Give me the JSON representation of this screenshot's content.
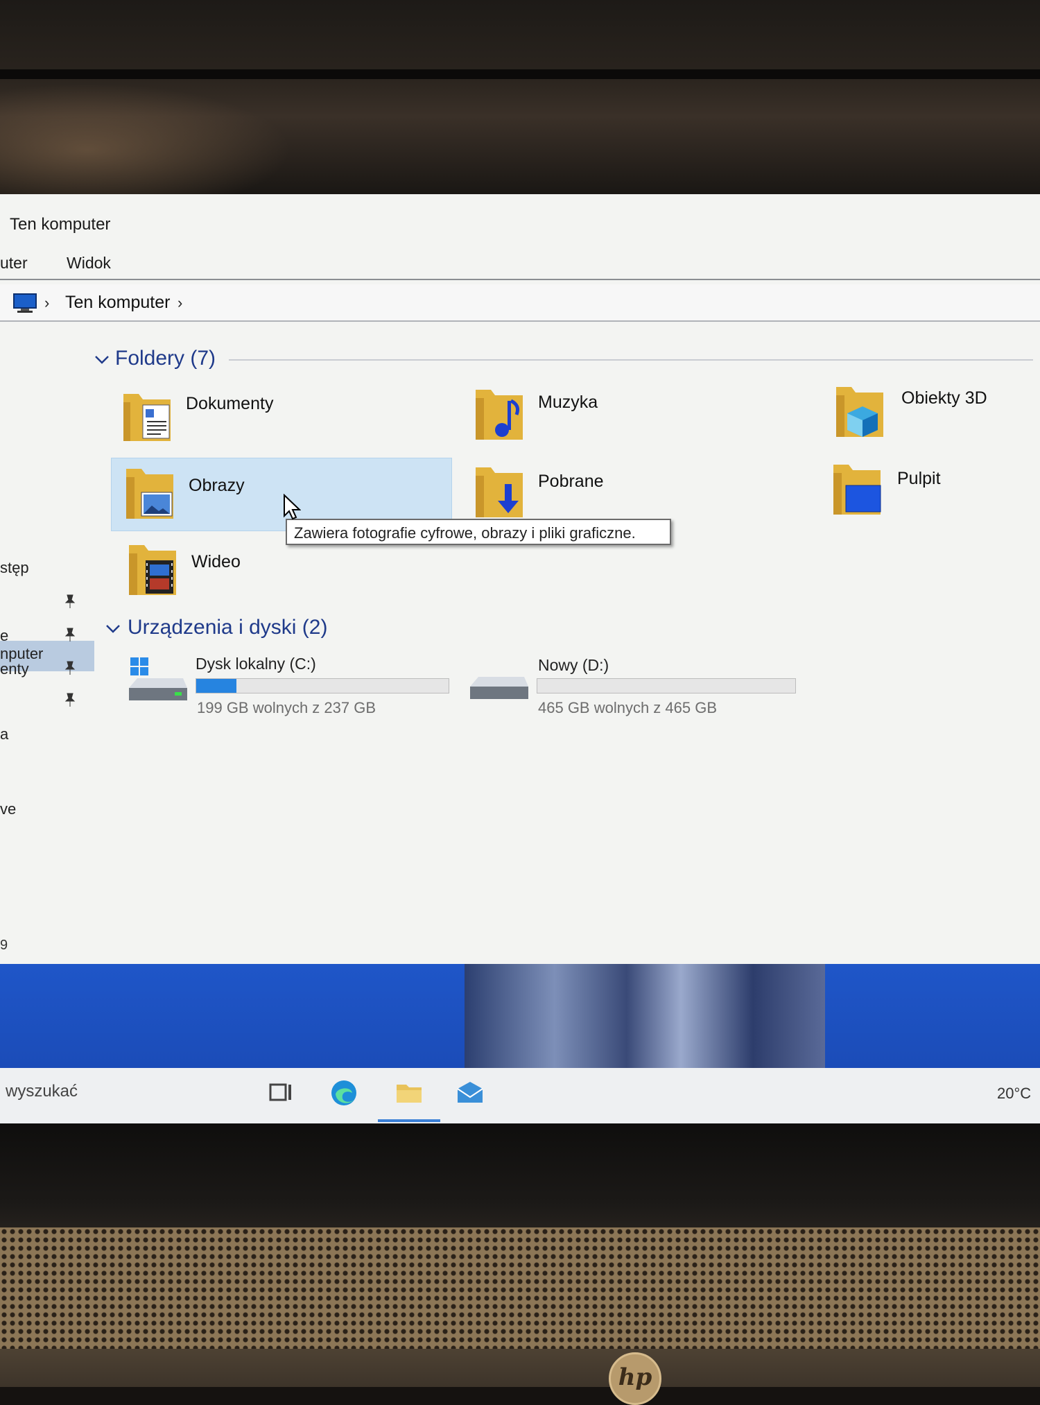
{
  "window": {
    "title": "Ten komputer",
    "ribbon_tabs": [
      "uter",
      "Widok"
    ],
    "breadcrumb": [
      "Ten komputer"
    ]
  },
  "nav": {
    "items": [
      "stęp",
      "e",
      "enty",
      "a",
      "ve",
      "nputer"
    ],
    "status_count": "9"
  },
  "folders_section": {
    "title": "Foldery (7)",
    "items": [
      {
        "label": "Dokumenty",
        "icon": "documents-folder-icon"
      },
      {
        "label": "Muzyka",
        "icon": "music-folder-icon"
      },
      {
        "label": "Obiekty 3D",
        "icon": "3d-objects-folder-icon"
      },
      {
        "label": "Obrazy",
        "icon": "pictures-folder-icon",
        "selected": true
      },
      {
        "label": "Pobrane",
        "icon": "downloads-folder-icon"
      },
      {
        "label": "Pulpit",
        "icon": "desktop-folder-icon"
      },
      {
        "label": "Wideo",
        "icon": "videos-folder-icon"
      }
    ]
  },
  "tooltip": "Zawiera fotografie cyfrowe, obrazy i pliki graficzne.",
  "drives_section": {
    "title": "Urządzenia i dyski (2)",
    "drives": [
      {
        "label": "Dysk lokalny (C:)",
        "free": "199 GB wolnych z 237 GB",
        "used_fraction": 0.16
      },
      {
        "label": "Nowy (D:)",
        "free": "465 GB wolnych z 465 GB",
        "used_fraction": 0.0
      }
    ]
  },
  "taskbar": {
    "search_placeholder": "wyszukać",
    "temperature": "20°C",
    "icons": [
      "task-view-icon",
      "edge-icon",
      "file-explorer-icon",
      "mail-icon"
    ]
  },
  "colors": {
    "accent": "#2684e0",
    "selection": "#cde3f4",
    "section_header": "#1f3a8a",
    "wallpaper": "#1f56c8"
  },
  "laptop": {
    "logo": "hp"
  }
}
